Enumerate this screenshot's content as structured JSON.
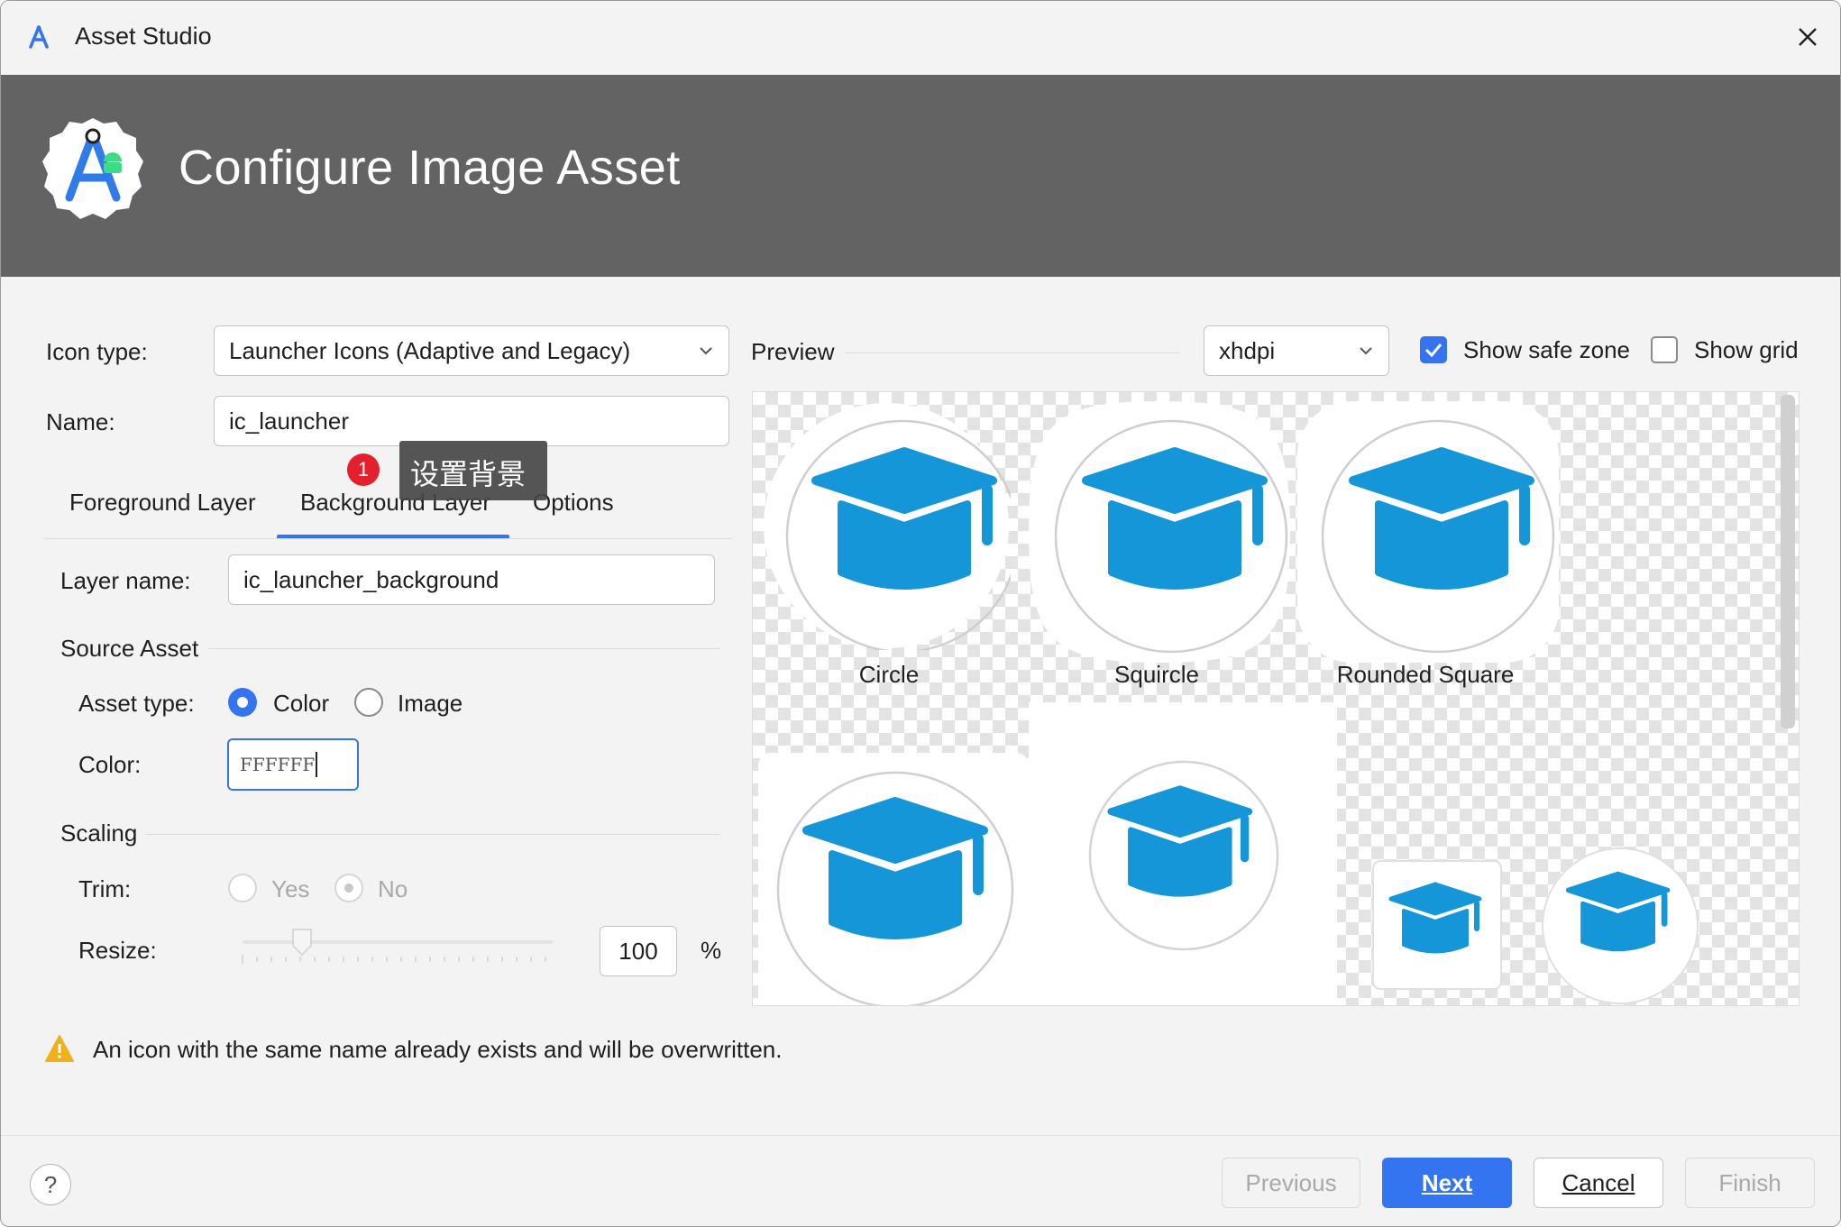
{
  "window": {
    "title": "Asset Studio",
    "close_label": "✕"
  },
  "banner": {
    "title": "Configure Image Asset"
  },
  "form": {
    "icon_type_label": "Icon type:",
    "icon_type_value": "Launcher Icons (Adaptive and Legacy)",
    "name_label": "Name:",
    "name_value": "ic_launcher"
  },
  "tooltip": {
    "badge": "1",
    "text": "设置背景"
  },
  "tabs": [
    {
      "label": "Foreground Layer",
      "selected": false
    },
    {
      "label": "Background Layer",
      "selected": true
    },
    {
      "label": "Options",
      "selected": false
    }
  ],
  "layer": {
    "layer_name_label": "Layer name:",
    "layer_name_value": "ic_launcher_background",
    "source_asset_heading": "Source Asset",
    "asset_type_label": "Asset type:",
    "asset_type_options": [
      "Color",
      "Image"
    ],
    "asset_type_selected": "Color",
    "color_label": "Color:",
    "color_value": "FFFFFF",
    "scaling_heading": "Scaling",
    "trim_label": "Trim:",
    "trim_options": [
      "Yes",
      "No"
    ],
    "trim_selected": "No",
    "resize_label": "Resize:",
    "resize_value": "100",
    "resize_unit": "%"
  },
  "preview": {
    "label": "Preview",
    "density_value": "xhdpi",
    "show_safe_zone_label": "Show safe zone",
    "show_safe_zone_checked": true,
    "show_grid_label": "Show grid",
    "show_grid_checked": false,
    "captions": [
      "Circle",
      "Squircle",
      "Rounded Square"
    ]
  },
  "warning": {
    "text": "An icon with the same name already exists and will be overwritten."
  },
  "footer": {
    "help_label": "?",
    "previous_label": "Previous",
    "next_label": "Next",
    "cancel_label": "Cancel",
    "finish_label": "Finish"
  },
  "colors": {
    "accent": "#3574f0",
    "banner": "#636363",
    "icon_blue": "#1596d9",
    "badge_red": "#e5202e",
    "warning": "#f0b01c"
  },
  "icons": [
    "android-studio-icon",
    "close-icon",
    "chevron-down-icon",
    "checkbox-check-icon",
    "warning-icon",
    "help-icon",
    "graduation-cap-icon"
  ]
}
